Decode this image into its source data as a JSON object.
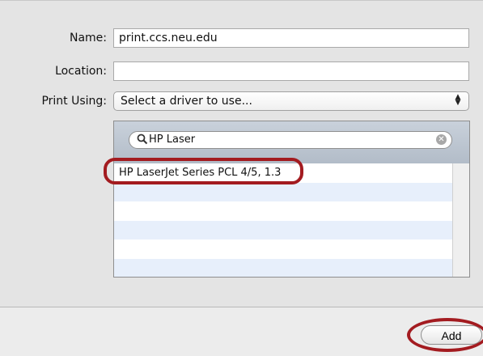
{
  "form": {
    "name_label": "Name:",
    "name_value": "print.ccs.neu.edu",
    "location_label": "Location:",
    "location_value": "",
    "print_using_label": "Print Using:",
    "print_using_value": "Select a driver to use..."
  },
  "driver_search": {
    "query": "HP Laser",
    "results": [
      "HP LaserJet Series PCL 4/5, 1.3",
      "",
      "",
      "",
      "",
      ""
    ]
  },
  "footer": {
    "add_label": "Add"
  },
  "annotation_color": "#a31b20"
}
